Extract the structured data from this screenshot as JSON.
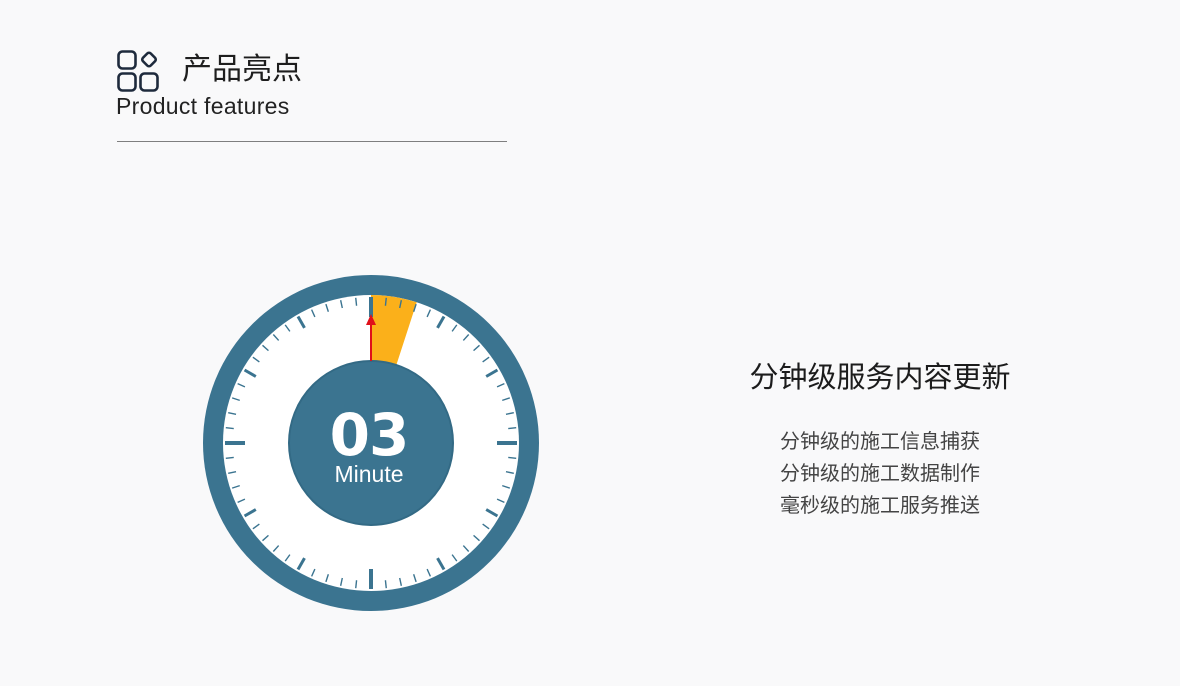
{
  "header": {
    "title_cn": "产品亮点",
    "title_en": "Product  features",
    "icon": "feature-grid-icon"
  },
  "stopwatch": {
    "value": "03",
    "unit": "Minute",
    "elapsed_fraction": 0.05,
    "colors": {
      "dial": "#3b7490",
      "face": "#ffffff",
      "progress": "#fbb01a",
      "hand": "#e0101a"
    }
  },
  "feature": {
    "heading": "分钟级服务内容更新",
    "items": [
      "分钟级的施工信息捕获",
      "分钟级的施工数据制作",
      "毫秒级的施工服务推送"
    ]
  }
}
